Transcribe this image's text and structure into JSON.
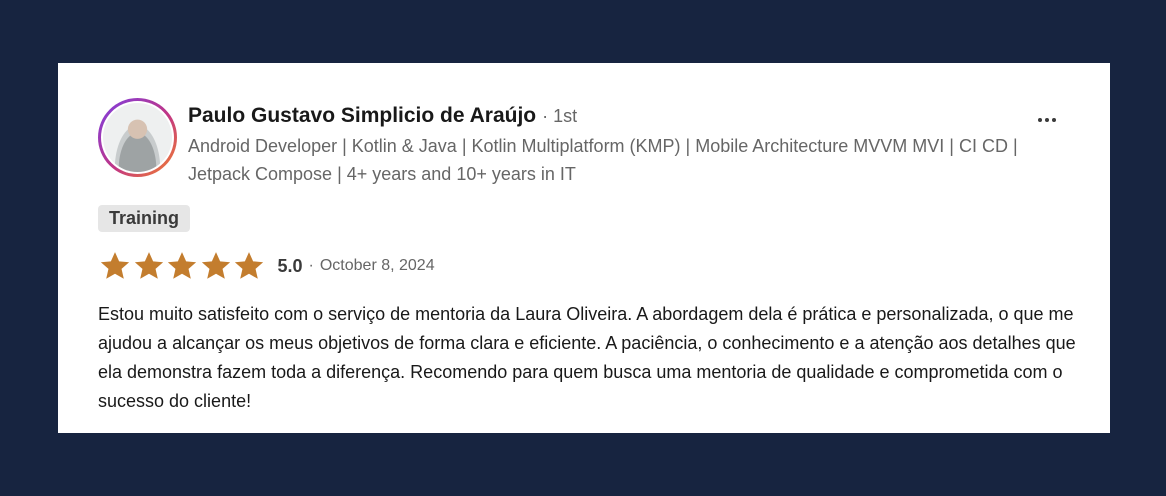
{
  "review": {
    "author": {
      "name": "Paulo Gustavo Simplicio de Araújo",
      "degree": "· 1st",
      "headline": "Android Developer | Kotlin & Java | Kotlin Multiplatform (KMP) | Mobile Architecture MVVM MVI | CI CD | Jetpack Compose | 4+ years and 10+ years in IT",
      "avatar_icon": "profile-photo"
    },
    "menu_icon": "more-horizontal-icon",
    "tag": "Training",
    "rating": {
      "stars": 5,
      "max_stars": 5,
      "score": "5.0",
      "separator": "·",
      "date": "October 8, 2024"
    },
    "text": "Estou muito satisfeito com o serviço de mentoria da Laura Oliveira. A abordagem dela é prática e personalizada, o que me ajudou a alcançar os meus objetivos de forma clara e eficiente. A paciência, o conhecimento e a atenção aos detalhes que ela demonstra fazem toda a diferença. Recomendo para quem busca uma mentoria de qualidade e comprometida com o sucesso do cliente!"
  },
  "colors": {
    "background": "#172440",
    "card": "#ffffff",
    "star": "#c37d2e",
    "tag_bg": "#e6e6e6",
    "secondary_text": "#666666"
  }
}
